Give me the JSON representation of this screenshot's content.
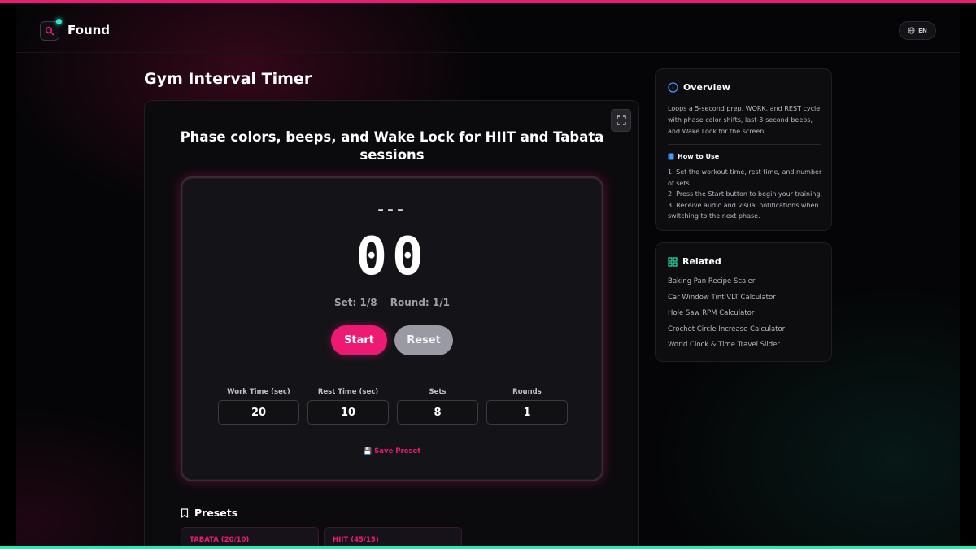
{
  "brand": {
    "name": "Found",
    "accent": "#ec1a73",
    "dot_color": "#2ee6d6"
  },
  "header": {
    "lang_label": "EN",
    "lang_icon": "globe-icon",
    "search_icon": "search-icon"
  },
  "page_title": "Gym Interval Timer",
  "tool": {
    "subtitle": "Phase colors, beeps, and Wake Lock for HIIT and Tabata sessions",
    "phase_label": "---",
    "time_display": "00",
    "set_counter": "Set: 1/8",
    "round_counter": "Round: 1/1",
    "start_label": "Start",
    "reset_label": "Reset",
    "fields": [
      {
        "label": "Work Time (sec)",
        "value": "20"
      },
      {
        "label": "Rest Time (sec)",
        "value": "10"
      },
      {
        "label": "Sets",
        "value": "8"
      },
      {
        "label": "Rounds",
        "value": "1"
      }
    ],
    "save_preset_label": "💾 Save Preset",
    "presets_title": "Presets",
    "presets": [
      {
        "label": "TABATA (20/10)"
      },
      {
        "label": "HIIT (45/15)"
      }
    ]
  },
  "overview": {
    "title": "Overview",
    "text": "Loops a 5-second prep, WORK, and REST cycle with phase color shifts, last-3-second beeps, and Wake Lock for the screen.",
    "howto_title": "How to Use",
    "steps": [
      "1. Set the workout time, rest time, and number of sets.",
      "2. Press the Start button to begin your training.",
      "3. Receive audio and visual notifications when switching to the next phase."
    ]
  },
  "related": {
    "title": "Related",
    "items": [
      "Baking Pan Recipe Scaler",
      "Car Window Tint VLT Calculator",
      "Hole Saw RPM Calculator",
      "Crochet Circle Increase Calculator",
      "World Clock & Time Travel Slider"
    ]
  }
}
